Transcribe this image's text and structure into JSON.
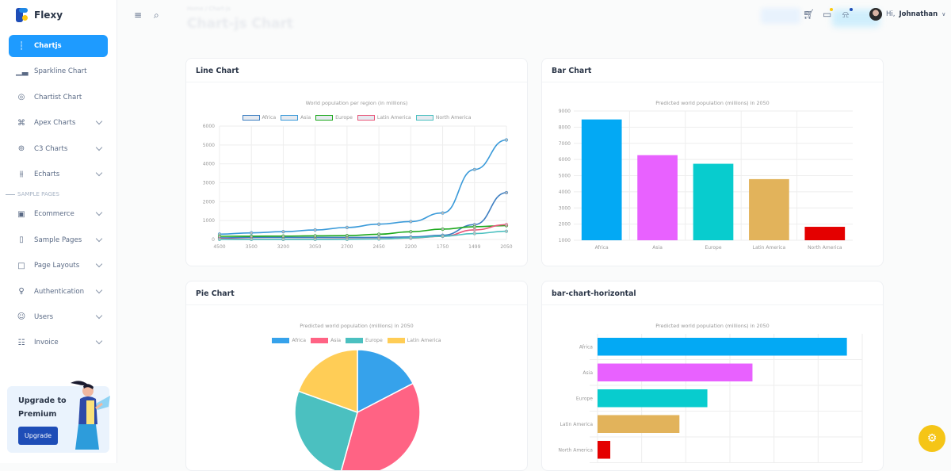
{
  "brand": {
    "name": "Flexy"
  },
  "sidebar": {
    "items": [
      {
        "label": "Chartjs",
        "icon": "bar-chart-icon",
        "active": true
      },
      {
        "label": "Sparkline Chart",
        "icon": "signal-icon"
      },
      {
        "label": "Chartist Chart",
        "icon": "target-icon"
      },
      {
        "label": "Apex Charts",
        "icon": "command-icon",
        "expandable": true
      },
      {
        "label": "C3 Charts",
        "icon": "lifebuoy-icon",
        "expandable": true
      },
      {
        "label": "Echarts",
        "icon": "sliders-icon",
        "expandable": true
      }
    ],
    "section_caption": "SAMPLE PAGES",
    "section_items": [
      {
        "label": "Ecommerce",
        "icon": "shopping-bag-icon",
        "expandable": true
      },
      {
        "label": "Sample Pages",
        "icon": "book-icon",
        "expandable": true
      },
      {
        "label": "Page Layouts",
        "icon": "clipboard-icon",
        "expandable": true
      },
      {
        "label": "Authentication",
        "icon": "user-check-icon",
        "expandable": true
      },
      {
        "label": "Users",
        "icon": "users-icon",
        "expandable": true
      },
      {
        "label": "Invoice",
        "icon": "file-text-icon",
        "expandable": true
      }
    ],
    "upgrade": {
      "title": "Upgrade to Premium",
      "button": "Upgrade"
    }
  },
  "header": {
    "breadcrumb": "Home / Chart-js",
    "page_title": "Chart-js Chart",
    "user_greeting": "Hi,",
    "user_name": "Johnathan"
  },
  "cards": {
    "line": {
      "title": "Line Chart"
    },
    "bar": {
      "title": "Bar Chart"
    },
    "pie": {
      "title": "Pie Chart"
    },
    "hbar": {
      "title": "bar-chart-horizontal"
    }
  },
  "chart_data": [
    {
      "type": "line",
      "title": "World population per region (in millions)",
      "categories": [
        "4500",
        "3500",
        "3200",
        "3050",
        "2700",
        "2450",
        "2200",
        "1750",
        "1499",
        "2050"
      ],
      "ylim": [
        0,
        6000
      ],
      "yticks": [
        0,
        1000,
        2000,
        3000,
        4000,
        5000,
        6000
      ],
      "grid": true,
      "legend": "top",
      "series": [
        {
          "name": "Africa",
          "color": "#3e7fc1",
          "values": [
            86,
            114,
            106,
            106,
            107,
            111,
            133,
            221,
            783,
            2478
          ]
        },
        {
          "name": "Asia",
          "color": "#3a9ad9",
          "values": [
            282,
            350,
            411,
            502,
            635,
            809,
            947,
            1402,
            3700,
            5267
          ]
        },
        {
          "name": "Europe",
          "color": "#1ca81c",
          "values": [
            168,
            170,
            178,
            190,
            203,
            276,
            408,
            547,
            675,
            734
          ]
        },
        {
          "name": "Latin America",
          "color": "#e8577a",
          "values": [
            40,
            20,
            10,
            16,
            24,
            38,
            74,
            167,
            508,
            784
          ]
        },
        {
          "name": "North America",
          "color": "#4bc0c0",
          "values": [
            6,
            3,
            2,
            2,
            7,
            26,
            82,
            172,
            312,
            433
          ]
        }
      ]
    },
    {
      "type": "bar",
      "title": "Predicted world population (millions) in 2050",
      "categories": [
        "Africa",
        "Asia",
        "Europe",
        "Latin America",
        "North America"
      ],
      "values": [
        8478,
        6267,
        5734,
        4784,
        1833
      ],
      "colors": [
        "#03a9f4",
        "#e861ff",
        "#08ccce",
        "#e2b35b",
        "#e40000"
      ],
      "ylim": [
        1000,
        9000
      ],
      "yticks": [
        1000,
        2000,
        3000,
        4000,
        5000,
        6000,
        7000,
        8000,
        9000
      ],
      "grid": true
    },
    {
      "type": "pie",
      "title": "Predicted world population (millions) in 2050",
      "legend": "top",
      "categories": [
        "Africa",
        "Asia",
        "Europe",
        "Latin America"
      ],
      "values": [
        2478,
        5267,
        3734,
        2784
      ],
      "colors": [
        "#36a2eb",
        "#ff6384",
        "#4bc0c0",
        "#ffcd56"
      ]
    },
    {
      "type": "bar",
      "orientation": "horizontal",
      "title": "Predicted world population (millions) in 2050",
      "categories": [
        "Africa",
        "Asia",
        "Europe",
        "Latin America",
        "North America"
      ],
      "values": [
        8478,
        5267,
        3734,
        2784,
        433
      ],
      "colors": [
        "#03a9f4",
        "#e861ff",
        "#08ccce",
        "#e2b35b",
        "#e40000"
      ],
      "xlim": [
        0,
        9000
      ],
      "grid": true
    }
  ]
}
